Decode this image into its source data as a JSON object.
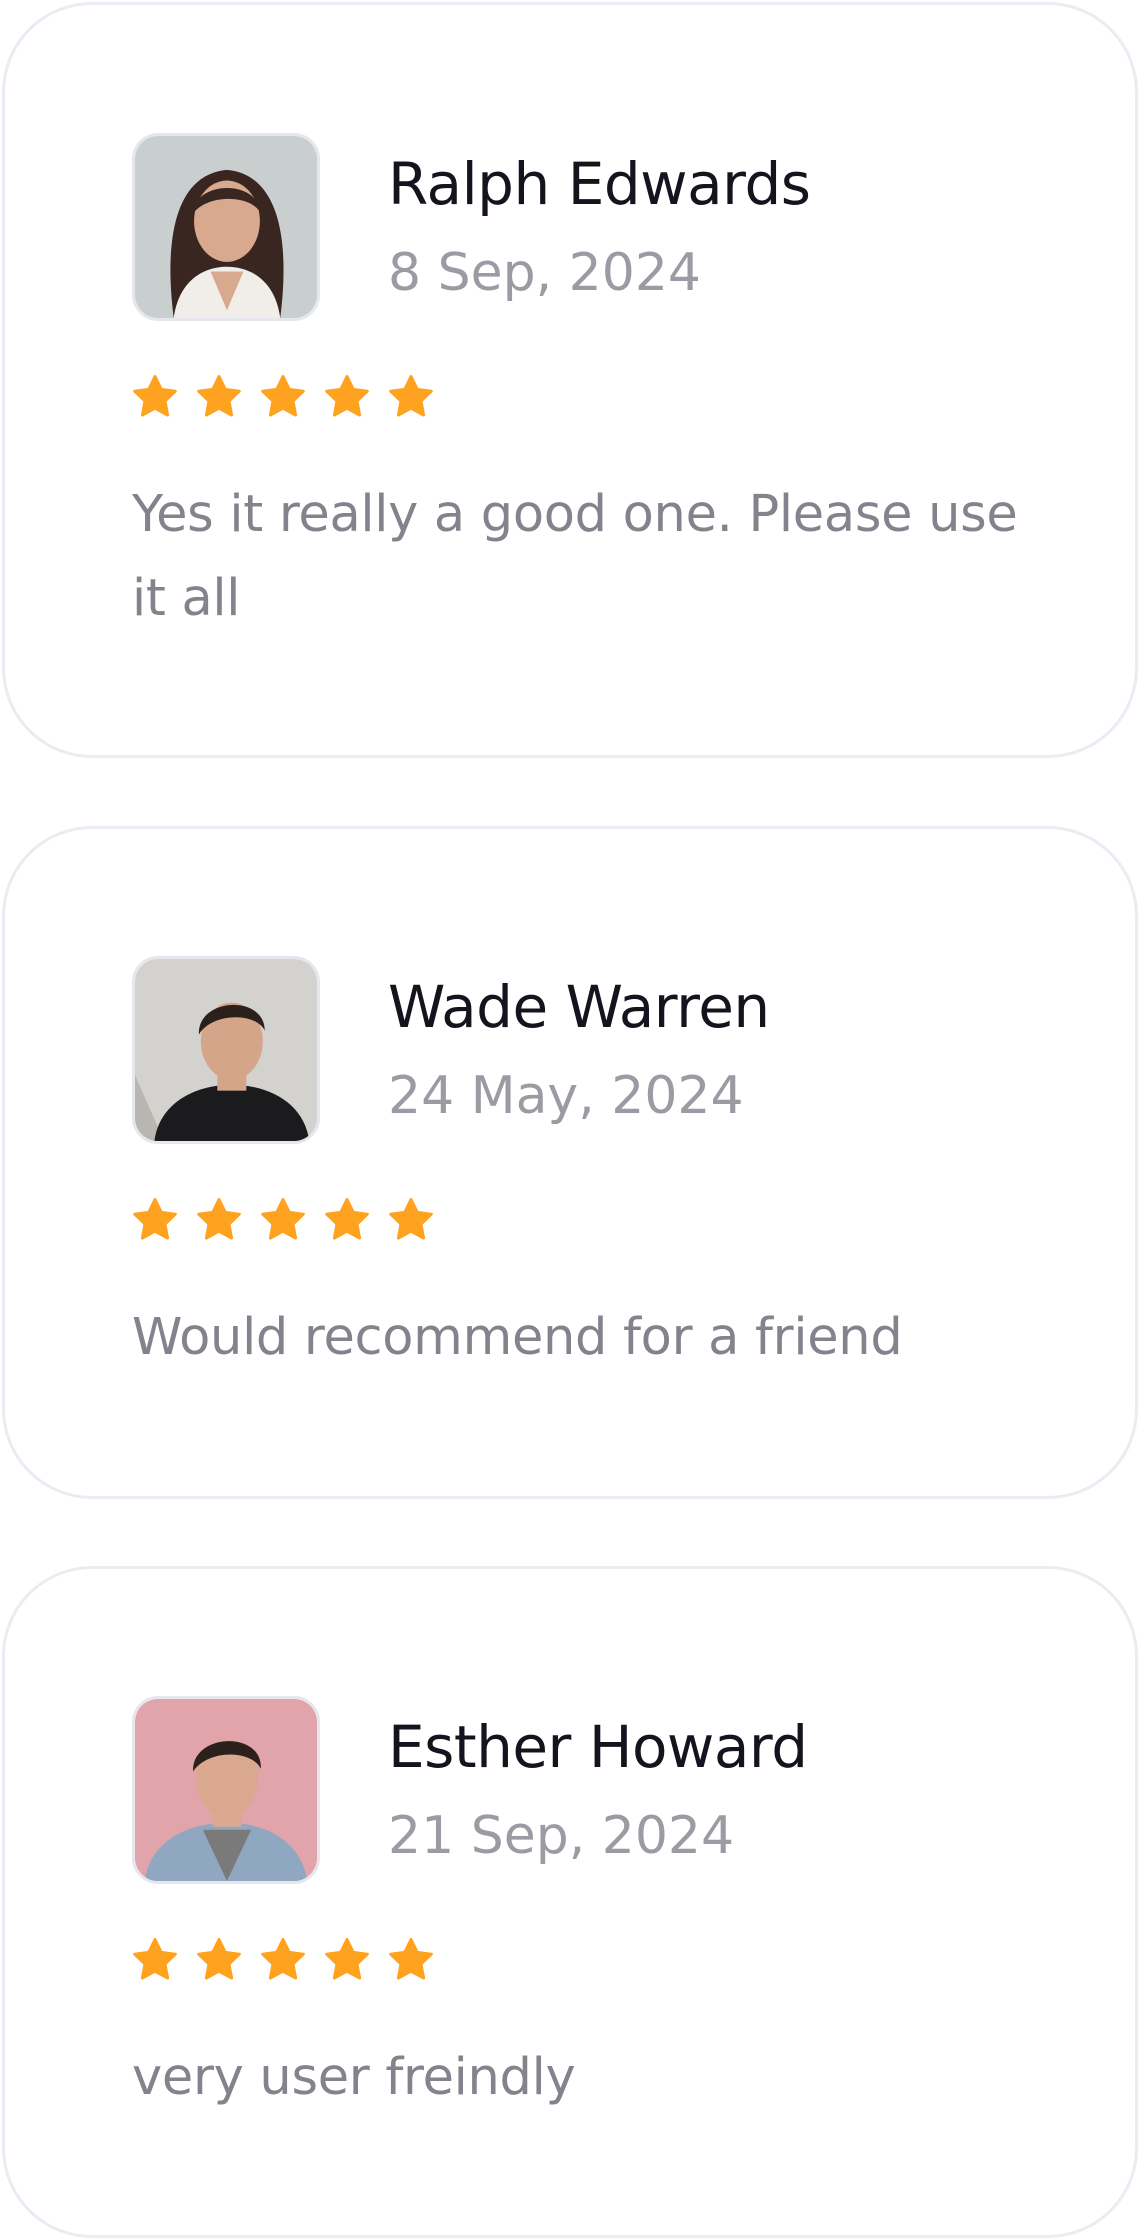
{
  "reviews": [
    {
      "name": "Ralph Edwards",
      "date": "8 Sep, 2024",
      "rating": 5,
      "text": "Yes it really a good one. Please use it all",
      "avatar_bg": "#c9cfcf"
    },
    {
      "name": "Wade Warren",
      "date": "24 May, 2024",
      "rating": 5,
      "text": "Would recommend for a friend",
      "avatar_bg": "#d4d2cf"
    },
    {
      "name": "Esther Howard",
      "date": "21 Sep, 2024",
      "rating": 5,
      "text": "very user freindly",
      "avatar_bg": "#e0a4aa"
    }
  ],
  "colors": {
    "star": "#ffa21f",
    "name": "#14141f",
    "date": "#9b9ba4",
    "body_text": "#83838d",
    "card_border": "#ebebf3"
  },
  "icons": {
    "star": "star-icon"
  }
}
